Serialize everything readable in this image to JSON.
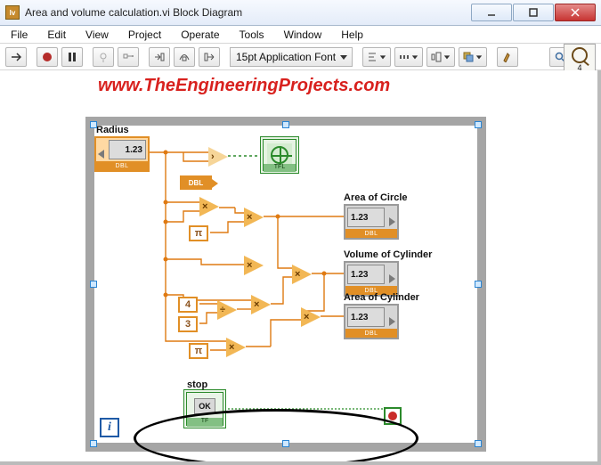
{
  "window": {
    "title": "Area and volume calculation.vi Block Diagram"
  },
  "menu": {
    "file": "File",
    "edit": "Edit",
    "view": "View",
    "project": "Project",
    "operate": "Operate",
    "tools": "Tools",
    "window": "Window",
    "help": "Help"
  },
  "toolbar": {
    "font": "15pt Application Font",
    "corner_count": "4"
  },
  "watermark": "www.TheEngineeringProjects.com",
  "nodes": {
    "radius": {
      "label": "Radius",
      "value": "1.23",
      "dtype": "DBL"
    },
    "probe": "DBL",
    "const4": "4",
    "const3": "3",
    "areaCircle": {
      "label": "Area of Circle",
      "value": "1.23",
      "dtype": "DBL"
    },
    "volCyl": {
      "label": "Volume of Cylinder",
      "value": "1.23",
      "dtype": "DBL"
    },
    "areaCyl": {
      "label": "Area of Cylinder",
      "value": "1.23",
      "dtype": "DBL"
    },
    "stop": {
      "label": "stop",
      "button": "OK",
      "dtype": "TF"
    },
    "express_dtype": "TFL",
    "iteration": "i"
  }
}
